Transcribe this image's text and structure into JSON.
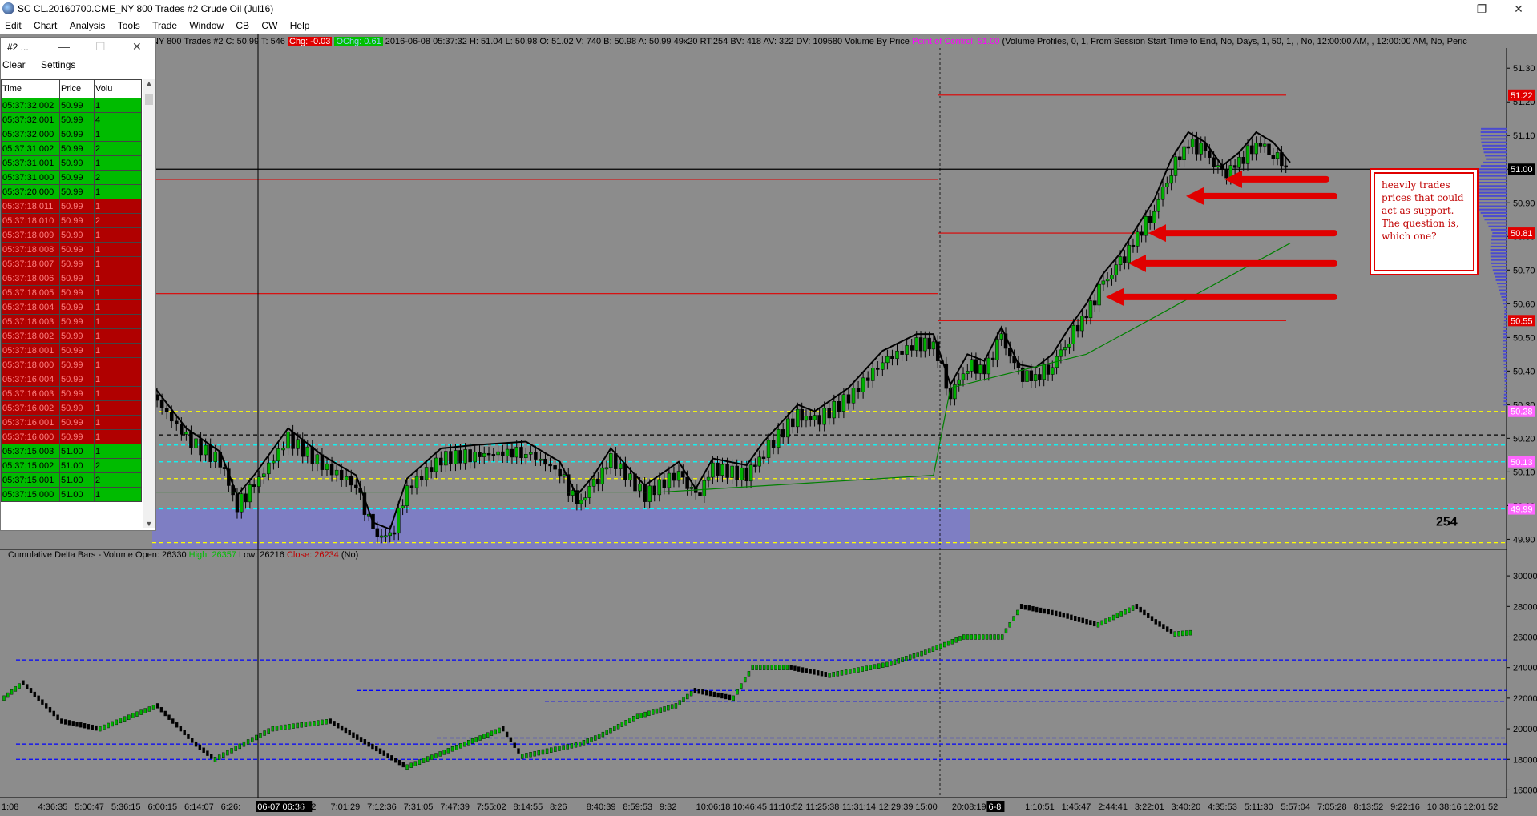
{
  "window": {
    "title": "SC CL.20160700.CME_NY  800 Trades  #2  Crude Oil (Jul16)"
  },
  "menu": [
    "Edit",
    "Chart",
    "Analysis",
    "Tools",
    "Trade",
    "Window",
    "CB",
    "CW",
    "Help"
  ],
  "time_and_sales": {
    "title": "#2 ...",
    "toolbar": [
      "Clear",
      "Settings"
    ],
    "columns": [
      "Time",
      "Price",
      "Volu"
    ],
    "rows": [
      {
        "time": "05:37:32.002",
        "price": "50.99",
        "vol": "1",
        "side": "buy"
      },
      {
        "time": "05:37:32.001",
        "price": "50.99",
        "vol": "4",
        "side": "buy"
      },
      {
        "time": "05:37:32.000",
        "price": "50.99",
        "vol": "1",
        "side": "buy"
      },
      {
        "time": "05:37:31.002",
        "price": "50.99",
        "vol": "2",
        "side": "buy"
      },
      {
        "time": "05:37:31.001",
        "price": "50.99",
        "vol": "1",
        "side": "buy"
      },
      {
        "time": "05:37:31.000",
        "price": "50.99",
        "vol": "2",
        "side": "buy"
      },
      {
        "time": "05:37:20.000",
        "price": "50.99",
        "vol": "1",
        "side": "buy"
      },
      {
        "time": "05:37:18.011",
        "price": "50.99",
        "vol": "1",
        "side": "sell"
      },
      {
        "time": "05:37:18.010",
        "price": "50.99",
        "vol": "2",
        "side": "sell"
      },
      {
        "time": "05:37:18.009",
        "price": "50.99",
        "vol": "1",
        "side": "sell"
      },
      {
        "time": "05:37:18.008",
        "price": "50.99",
        "vol": "1",
        "side": "sell"
      },
      {
        "time": "05:37:18.007",
        "price": "50.99",
        "vol": "1",
        "side": "sell"
      },
      {
        "time": "05:37:18.006",
        "price": "50.99",
        "vol": "1",
        "side": "sell"
      },
      {
        "time": "05:37:18.005",
        "price": "50.99",
        "vol": "1",
        "side": "sell"
      },
      {
        "time": "05:37:18.004",
        "price": "50.99",
        "vol": "1",
        "side": "sell"
      },
      {
        "time": "05:37:18.003",
        "price": "50.99",
        "vol": "1",
        "side": "sell"
      },
      {
        "time": "05:37:18.002",
        "price": "50.99",
        "vol": "1",
        "side": "sell"
      },
      {
        "time": "05:37:18.001",
        "price": "50.99",
        "vol": "1",
        "side": "sell"
      },
      {
        "time": "05:37:18.000",
        "price": "50.99",
        "vol": "1",
        "side": "sell"
      },
      {
        "time": "05:37:16.004",
        "price": "50.99",
        "vol": "1",
        "side": "sell"
      },
      {
        "time": "05:37:16.003",
        "price": "50.99",
        "vol": "1",
        "side": "sell"
      },
      {
        "time": "05:37:16.002",
        "price": "50.99",
        "vol": "1",
        "side": "sell"
      },
      {
        "time": "05:37:16.001",
        "price": "50.99",
        "vol": "1",
        "side": "sell"
      },
      {
        "time": "05:37:16.000",
        "price": "50.99",
        "vol": "1",
        "side": "sell"
      },
      {
        "time": "05:37:15.003",
        "price": "51.00",
        "vol": "1",
        "side": "buy"
      },
      {
        "time": "05:37:15.002",
        "price": "51.00",
        "vol": "2",
        "side": "buy"
      },
      {
        "time": "05:37:15.001",
        "price": "51.00",
        "vol": "2",
        "side": "buy"
      },
      {
        "time": "05:37:15.000",
        "price": "51.00",
        "vol": "1",
        "side": "buy"
      }
    ]
  },
  "info_bar": {
    "prefix": "NY  800 Trades  #2  C: 50.99  T: 546",
    "chg": "Chg: -0.03",
    "ochg": "OChg: 0.61",
    "details": "2016-06-08 05:37:32  H: 51.04  L: 50.98  O: 51.02  V: 740  B: 50.98  A: 50.99  49x20  RT:254  BV: 418  AV: 322  DV: 109580  Volume By Price",
    "poc": "Point of Control: 51.00",
    "study": "(Volume Profiles, 0, 1, From Session Start Time to End, No, Days, 1, 50, 1, , No, 12:00:00 AM, , 12:00:00 AM, No, Peric"
  },
  "price_axis": {
    "ticks": [
      "51.30",
      "51.20",
      "51.10",
      "51.00",
      "50.90",
      "50.80",
      "50.70",
      "50.60",
      "50.50",
      "50.40",
      "50.30",
      "50.20",
      "50.10",
      "50.00",
      "49.90"
    ],
    "marker_labels": [
      {
        "text": "51.22",
        "color": "#e00000"
      },
      {
        "text": "51.00",
        "color": "#000000"
      },
      {
        "text": "50.81",
        "color": "#e00000"
      },
      {
        "text": "50.55",
        "color": "#e00000"
      },
      {
        "text": "50.28",
        "color": "#ff66ff"
      },
      {
        "text": "50.13",
        "color": "#ff66ff"
      },
      {
        "text": "49.99",
        "color": "#ff66ff"
      }
    ]
  },
  "lower_axis": {
    "ticks": [
      "30000",
      "28000",
      "26000",
      "24000",
      "22000",
      "20000",
      "18000",
      "16000"
    ]
  },
  "time_axis": {
    "labels": [
      "1:08",
      "4:36:35",
      "5:00:47",
      "5:36:15",
      "6:00:15",
      "6:14:07",
      "6:26:",
      "06-07 06:36",
      "48:12",
      "7:01:29",
      "7:12:36",
      "7:31:05",
      "7:47:39",
      "7:55:02",
      "8:14:55",
      "8:26",
      "8:40:39",
      "8:59:53",
      "9:32",
      "10:06:18",
      "10:46:45",
      "11:10:52",
      "11:25:38",
      "11:31:14",
      "12:29:39",
      "15:00",
      "20:08:19",
      "6-8",
      "1:10:51",
      "1:45:47",
      "2:44:41",
      "3:22:01",
      "3:40:20",
      "4:35:53",
      "5:11:30",
      "5:57:04",
      "7:05:28",
      "8:13:52",
      "9:22:16",
      "10:38:16",
      "12:01:52"
    ]
  },
  "counter_label": "254",
  "annotation": {
    "text": "heavily trades prices that could act as support.  The question is, which one?"
  },
  "lower_panel": {
    "label": "Cumulative Delta Bars - Volume  Open: 26330",
    "high": "High: 26357",
    "low": "Low: 26216",
    "close": "Close: 26234",
    "suffix": "(No)"
  },
  "colors": {
    "chart_bg": "#8c8c8c",
    "up": "#00b000",
    "down": "#000000",
    "arrow": "#e00000"
  },
  "chart_data": {
    "type": "line",
    "symbol": "CL Crude Oil (Jul16)",
    "price_range": [
      49.87,
      51.36
    ],
    "price_path": [
      [
        0,
        50.33
      ],
      [
        2,
        50.2
      ],
      [
        4,
        50.13
      ],
      [
        5,
        50.0
      ],
      [
        6,
        50.06
      ],
      [
        8,
        50.2
      ],
      [
        10,
        50.12
      ],
      [
        12,
        50.06
      ],
      [
        13,
        49.92
      ],
      [
        14,
        49.9
      ],
      [
        15,
        50.05
      ],
      [
        17,
        50.14
      ],
      [
        19,
        50.15
      ],
      [
        22,
        50.16
      ],
      [
        24,
        50.1
      ],
      [
        25,
        50.0
      ],
      [
        26,
        50.06
      ],
      [
        27,
        50.14
      ],
      [
        29,
        50.03
      ],
      [
        31,
        50.1
      ],
      [
        32,
        50.02
      ],
      [
        33,
        50.11
      ],
      [
        35,
        50.09
      ],
      [
        36,
        50.16
      ],
      [
        38,
        50.27
      ],
      [
        39,
        50.25
      ],
      [
        41,
        50.32
      ],
      [
        43,
        50.43
      ],
      [
        45,
        50.48
      ],
      [
        46,
        50.48
      ],
      [
        47,
        50.33
      ],
      [
        48,
        50.42
      ],
      [
        49,
        50.4
      ],
      [
        50,
        50.5
      ],
      [
        51,
        50.39
      ],
      [
        52,
        50.38
      ],
      [
        53,
        50.42
      ],
      [
        54,
        50.5
      ],
      [
        55,
        50.57
      ],
      [
        56,
        50.66
      ],
      [
        57,
        50.72
      ],
      [
        58,
        50.8
      ],
      [
        59,
        50.88
      ],
      [
        60,
        51.0
      ],
      [
        61,
        51.08
      ],
      [
        62,
        51.05
      ],
      [
        63,
        50.98
      ],
      [
        64,
        51.02
      ],
      [
        65,
        51.08
      ],
      [
        66,
        51.05
      ],
      [
        67,
        50.99
      ]
    ],
    "cum_delta_range": [
      15500,
      31000
    ],
    "cum_delta_path": [
      [
        0,
        22000
      ],
      [
        1,
        23000
      ],
      [
        3,
        20500
      ],
      [
        5,
        20000
      ],
      [
        8,
        21500
      ],
      [
        10,
        19000
      ],
      [
        11,
        18000
      ],
      [
        14,
        20000
      ],
      [
        17,
        20500
      ],
      [
        19,
        19000
      ],
      [
        21,
        17500
      ],
      [
        24,
        19000
      ],
      [
        26,
        20000
      ],
      [
        27,
        18200
      ],
      [
        30,
        19000
      ],
      [
        31,
        19500
      ],
      [
        33,
        20800
      ],
      [
        35,
        21500
      ],
      [
        36,
        22500
      ],
      [
        38,
        22000
      ],
      [
        39,
        24000
      ],
      [
        41,
        24000
      ],
      [
        43,
        23500
      ],
      [
        46,
        24200
      ],
      [
        48,
        25000
      ],
      [
        50,
        26000
      ],
      [
        52,
        26000
      ],
      [
        53,
        28000
      ],
      [
        55,
        27500
      ],
      [
        57,
        26800
      ],
      [
        59,
        28000
      ],
      [
        60,
        27000
      ],
      [
        61,
        26200
      ],
      [
        62,
        26300
      ]
    ],
    "levels_red": [
      51.22,
      50.97,
      50.81,
      50.63,
      50.55
    ],
    "levels_yellow": [
      50.28,
      50.08,
      49.89
    ],
    "levels_cyan": [
      50.18,
      50.13,
      49.99
    ],
    "level_black": [
      50.21,
      51.0
    ],
    "delta_levels": [
      24500,
      22500,
      21800,
      19400,
      19000,
      18000
    ]
  }
}
